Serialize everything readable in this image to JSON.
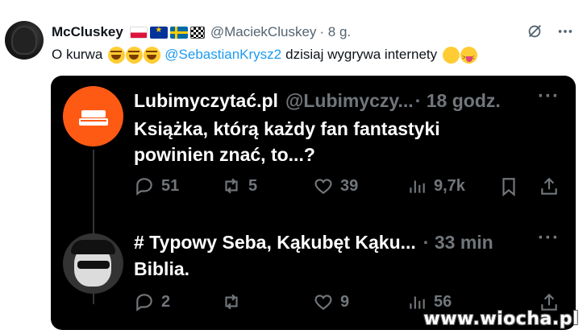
{
  "post": {
    "author_name": "McCluskey",
    "handle": "@MaciekCluskey",
    "time": "· 8 g.",
    "flags": [
      "poland-flag",
      "eu-flag",
      "sweden-flag",
      "checkered-flag"
    ],
    "text_before": "O kurwa",
    "mention": "@SebastianKrysz2",
    "text_after": "dzisiaj wygrywa internety"
  },
  "quoted_tweets": [
    {
      "name": "Lubimyczytać.pl",
      "handle": "@Lubimyczy...",
      "time": "· 18 godz.",
      "line1": "Książka, którą każdy fan fantastyki",
      "line2": "powinien znać, to...?",
      "replies": "51",
      "retweets": "5",
      "likes": "39",
      "views": "9,7k"
    },
    {
      "name": "# Typowy Seba, Kąkubęt Kąku...",
      "time": "· 33 min",
      "line1": "Biblia.",
      "replies": "2",
      "likes": "9",
      "views": "56"
    }
  ],
  "watermark": "www.wiocha.pl",
  "colors": {
    "accent": "#1d9bf0",
    "muted": "#536471",
    "dark_bg": "#000000",
    "dark_muted": "#71767b",
    "brand_orange": "#ff5a14"
  }
}
